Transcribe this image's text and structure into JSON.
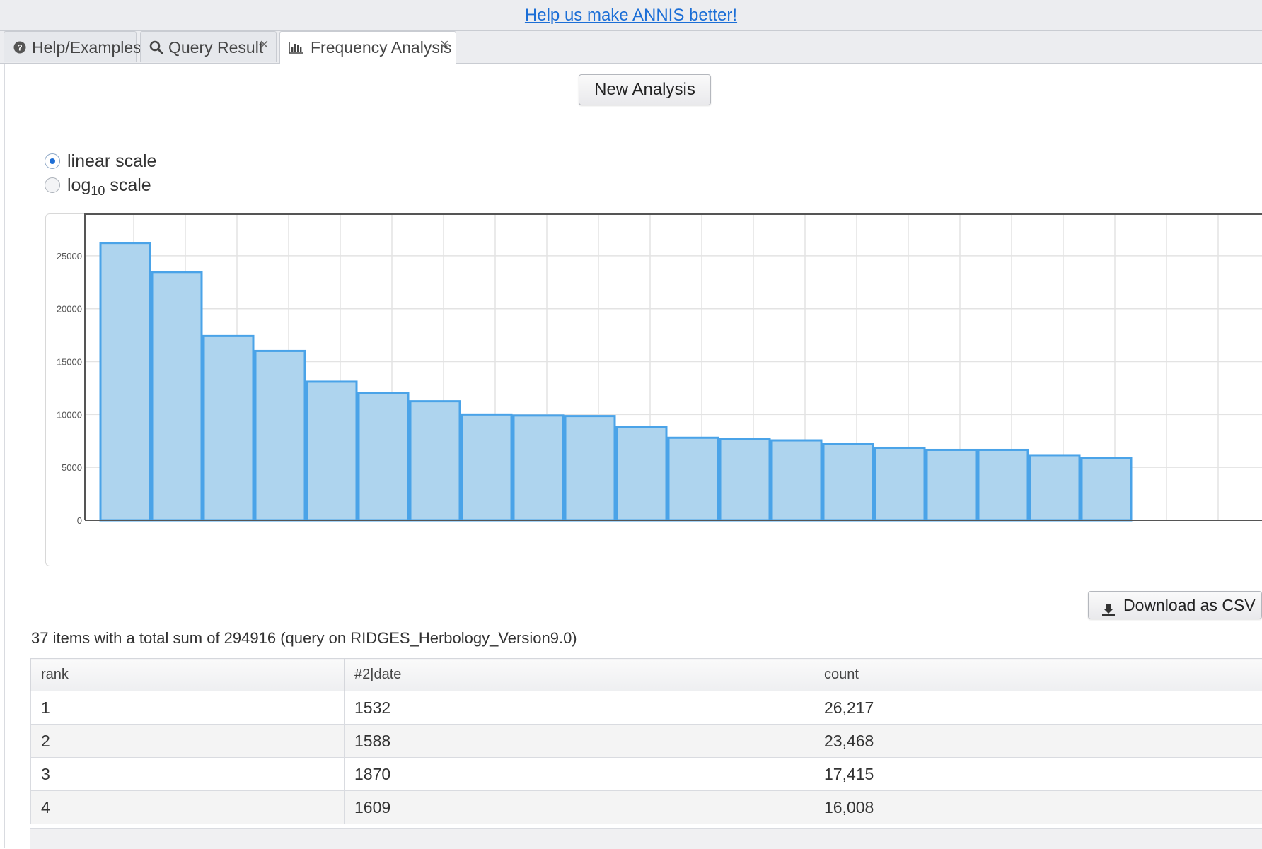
{
  "banner": {
    "link_text": "Help us make ANNIS better!"
  },
  "tabs": [
    {
      "label": "Help/Examples",
      "icon": "question-circle-icon",
      "closable": false
    },
    {
      "label": "Query Result",
      "icon": "search-icon",
      "closable": true
    },
    {
      "label": "Frequency Analysis",
      "icon": "bar-chart-icon",
      "closable": true,
      "active": true
    }
  ],
  "tab_close_glyph": "×",
  "new_analysis_label": "New Analysis",
  "scale": {
    "linear_label": "linear scale",
    "log_label_base": "log",
    "log_label_sub": "10",
    "log_label_rest": " scale",
    "selected": "linear"
  },
  "chart_data": {
    "type": "bar",
    "title": "",
    "xlabel": "",
    "ylabel": "",
    "ylim": [
      0,
      29000
    ],
    "yticks": [
      0,
      5000,
      10000,
      15000,
      20000,
      25000
    ],
    "grid": true,
    "bar_fill": "#aed4ee",
    "bar_stroke": "#4aa3e8",
    "values": [
      26217,
      23468,
      17415,
      16008,
      13100,
      12050,
      11250,
      10000,
      9900,
      9850,
      8850,
      7800,
      7700,
      7550,
      7250,
      6850,
      6650,
      6650,
      6150,
      5900
    ]
  },
  "download_label": "Download as CSV",
  "summary_text": "37 items with a total sum of 294916 (query on RIDGES_Herbology_Version9.0)",
  "table": {
    "headers": [
      "rank",
      "#2|date",
      "count"
    ],
    "rows": [
      [
        "1",
        "1532",
        "26,217"
      ],
      [
        "2",
        "1588",
        "23,468"
      ],
      [
        "3",
        "1870",
        "17,415"
      ],
      [
        "4",
        "1609",
        "16,008"
      ]
    ]
  }
}
